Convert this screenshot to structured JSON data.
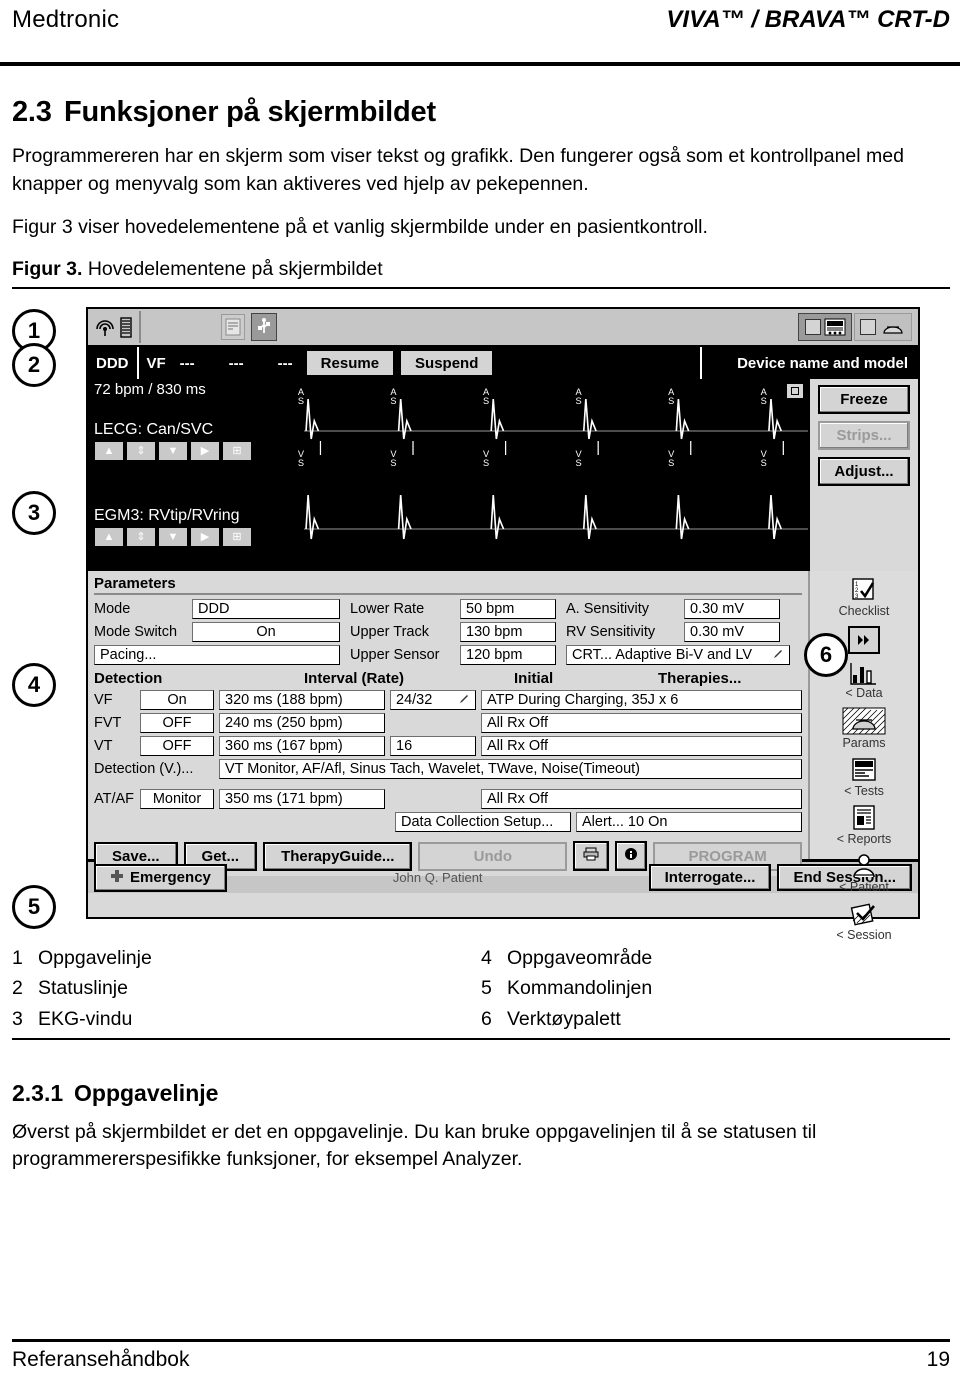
{
  "header": {
    "left": "Medtronic",
    "right": "VIVA™ / BRAVA™ CRT-D"
  },
  "section": {
    "number": "2.3",
    "title": "Funksjoner på skjermbildet",
    "para1": "Programmereren har en skjerm som viser tekst og grafikk. Den fungerer også som et kontrollpanel med knapper og menyvalg som kan aktiveres ved hjelp av pekepennen.",
    "para2": "Figur 3 viser hovedelementene på et vanlig skjermbilde under en pasientkontroll.",
    "figure_label": "Figur 3.",
    "figure_caption": "Hovedelementene på skjermbildet"
  },
  "subsection": {
    "number": "2.3.1",
    "title": "Oppgavelinje",
    "para1": "Øverst på skjermbildet er det en oppgavelinje. Du kan bruke oppgavelinjen til å se statusen til programmererspesifikke funksjoner, for eksempel Analyzer."
  },
  "callouts": [
    "1",
    "2",
    "3",
    "4",
    "5",
    "6"
  ],
  "figure": {
    "taskbar": {
      "icons": [
        "telemetry-antenna-icon",
        "battery-icon",
        "report-icon",
        "usb-icon",
        "window-small-icon",
        "device-monitor-icon",
        "window-small-icon-2",
        "device-can-icon"
      ]
    },
    "statusbar": {
      "mode": "DDD",
      "episode": "VF",
      "dashes": [
        "---",
        "---",
        "---"
      ],
      "resume_label": "Resume",
      "suspend_label": "Suspend",
      "device_text": "Device name and model"
    },
    "ecg": {
      "rate": "72 bpm / 830 ms",
      "trace1_label": "LECG: Can/SVC",
      "trace2_label": "EGM3: RVtip/RVring",
      "trace_controls": [
        "up-arrow-icon",
        "autoscale-icon",
        "down-arrow-icon",
        "play-arrow-icon",
        "layout-icon"
      ],
      "marker_atrial": "AS",
      "marker_ventricular": "VS",
      "buttons": [
        {
          "label": "Freeze",
          "disabled": false
        },
        {
          "label": "Strips...",
          "disabled": true
        },
        {
          "label": "Adjust...",
          "disabled": false
        }
      ]
    },
    "parameters": {
      "title": "Parameters",
      "rows": [
        {
          "label": "Mode",
          "value": "DDD",
          "label2": "Lower Rate",
          "value2": "50 bpm",
          "label3": "A. Sensitivity",
          "value3": "0.30 mV"
        },
        {
          "label": "Mode Switch",
          "value": "On",
          "label2": "Upper Track",
          "value2": "130 bpm",
          "label3": "RV Sensitivity",
          "value3": "0.30 mV"
        },
        {
          "label": "Pacing...",
          "value": "",
          "label2": "Upper Sensor",
          "value2": "120 bpm",
          "label3": "CRT... Adaptive Bi-V and LV",
          "value3": ""
        }
      ]
    },
    "detection": {
      "headers": [
        "Detection",
        "Interval (Rate)",
        "Initial",
        "Therapies..."
      ],
      "rows": [
        {
          "name": "VF",
          "state": "On",
          "interval": "320 ms (188 bpm)",
          "initial": "24/32",
          "initial_icon": true,
          "therapy": "ATP During Charging, 35J x 6"
        },
        {
          "name": "FVT",
          "state": "OFF",
          "interval": "240 ms (250 bpm)",
          "initial": "",
          "initial_icon": false,
          "therapy": "All Rx Off"
        },
        {
          "name": "VT",
          "state": "OFF",
          "interval": "360 ms (167 bpm)",
          "initial": "16",
          "initial_icon": false,
          "therapy": "All Rx Off"
        }
      ],
      "detection_v_label": "Detection (V.)...",
      "detection_v_value": "VT Monitor, AF/Afl, Sinus Tach, Wavelet, TWave, Noise(Timeout)",
      "ataf_label": "AT/AF",
      "ataf_state": "Monitor",
      "ataf_interval": "350 ms (171 bpm)",
      "ataf_therapy": "All Rx Off",
      "data_collection": "Data Collection Setup...",
      "alert": "Alert... 10 On"
    },
    "actions": [
      {
        "label": "Save...",
        "disabled": false
      },
      {
        "label": "Get...",
        "disabled": false
      },
      {
        "label": "TherapyGuide...",
        "disabled": false
      },
      {
        "label": "Undo",
        "disabled": true
      },
      {
        "label": "PROGRAM",
        "disabled": true
      }
    ],
    "action_icons": [
      "printer-icon",
      "info-icon"
    ],
    "commandline": {
      "emergency": "Emergency",
      "patient": "John Q. Patient",
      "interrogate": "Interrogate...",
      "end_session": "End Session..."
    },
    "palette": [
      {
        "label": "Checklist",
        "icon": "checklist-icon",
        "selected": false
      },
      {
        "label": "< Data",
        "icon": "data-chart-icon",
        "selected": false
      },
      {
        "label": "Params",
        "icon": "params-device-icon",
        "selected": true
      },
      {
        "label": "< Tests",
        "icon": "tests-icon",
        "selected": false
      },
      {
        "label": "< Reports",
        "icon": "reports-icon",
        "selected": false
      },
      {
        "label": "< Patient",
        "icon": "patient-person-icon",
        "selected": false
      },
      {
        "label": "< Session",
        "icon": "session-icon",
        "selected": false
      }
    ]
  },
  "legend": [
    {
      "num": "1",
      "text": "Oppgavelinje"
    },
    {
      "num": "2",
      "text": "Statuslinje"
    },
    {
      "num": "3",
      "text": "EKG-vindu"
    },
    {
      "num": "4",
      "text": "Oppgaveområde"
    },
    {
      "num": "5",
      "text": "Kommandolinjen"
    },
    {
      "num": "6",
      "text": "Verktøypalett"
    }
  ],
  "footer": {
    "left": "Referansehåndbok",
    "right": "19"
  }
}
